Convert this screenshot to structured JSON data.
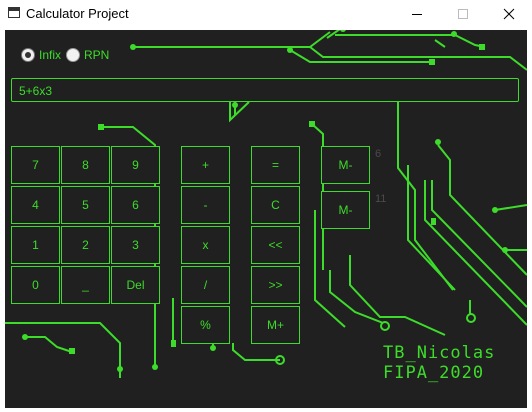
{
  "window": {
    "title": "Calculator Project",
    "icon": "app-window-icon",
    "controls": [
      "minimize",
      "maximize",
      "close"
    ]
  },
  "mode": {
    "options": [
      {
        "label": "Infix",
        "selected": true
      },
      {
        "label": "RPN",
        "selected": false
      }
    ]
  },
  "display": {
    "value": "5+6x3"
  },
  "keypad": {
    "numbers": [
      "7",
      "8",
      "9",
      "4",
      "5",
      "6",
      "1",
      "2",
      "3",
      "0",
      "_",
      "Del"
    ],
    "operators": [
      "+",
      "-",
      "x",
      "/",
      "%"
    ],
    "actions": [
      "=",
      "C",
      "<<",
      ">>",
      "M+"
    ],
    "memory": [
      "M-",
      "M-"
    ]
  },
  "ghost_labels": [
    "6",
    "11"
  ],
  "signature": {
    "line1": "TB_Nicolas",
    "line2": "FIPA_2020"
  },
  "colors": {
    "accent": "#3ddc2a",
    "background": "#202020",
    "ghost_text": "#4a4a4a"
  }
}
